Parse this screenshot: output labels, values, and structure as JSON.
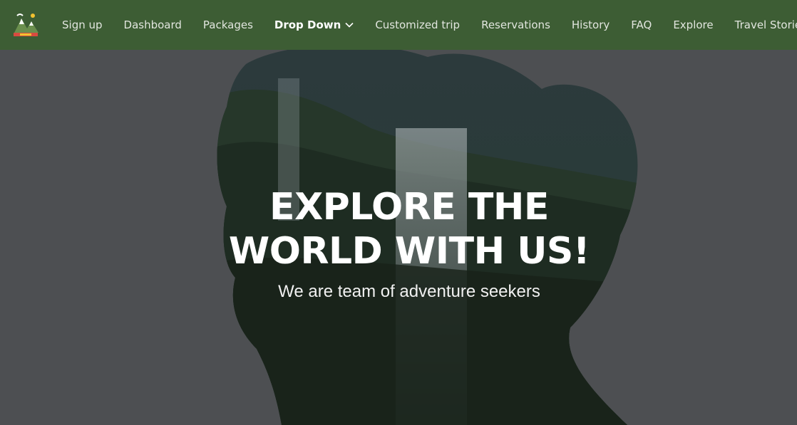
{
  "nav": {
    "logo_icon": "mountain-travel-logo-icon",
    "items": [
      {
        "label": "Sign up"
      },
      {
        "label": "Dashboard"
      },
      {
        "label": "Packages"
      },
      {
        "label": "Drop Down",
        "active": true,
        "icon": "chevron-down-icon"
      },
      {
        "label": "Customized trip"
      },
      {
        "label": "Reservations"
      },
      {
        "label": "History"
      },
      {
        "label": "FAQ"
      },
      {
        "label": "Explore"
      },
      {
        "label": "Travel Stories"
      }
    ]
  },
  "hero": {
    "title_line1": "EXPLORE THE",
    "title_line2": "WORLD WITH US!",
    "subtitle": "We are team of adventure seekers"
  },
  "colors": {
    "navbar": "#3d5d34",
    "hero_overlay": "#4d4f52",
    "text": "#ffffff"
  }
}
